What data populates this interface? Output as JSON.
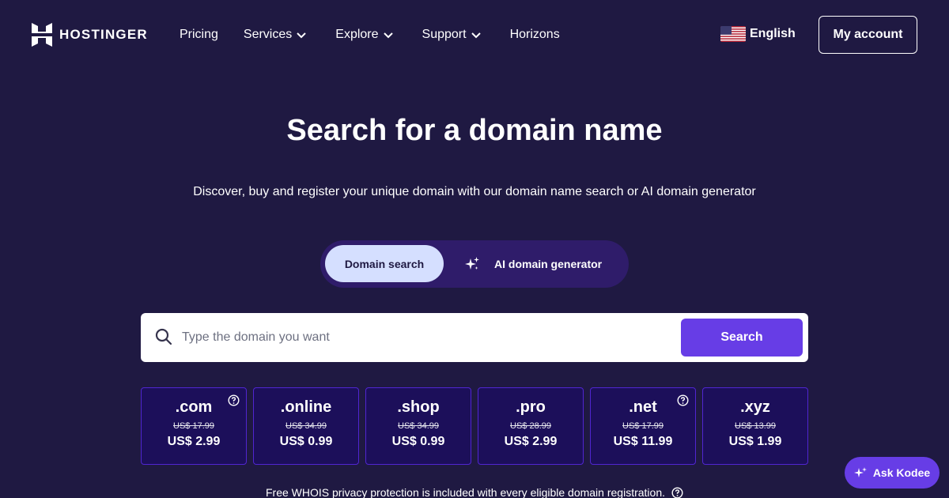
{
  "header": {
    "logo_text": "HOSTINGER",
    "nav": [
      {
        "label": "Pricing",
        "has_dropdown": false
      },
      {
        "label": "Services",
        "has_dropdown": true
      },
      {
        "label": "Explore",
        "has_dropdown": true
      },
      {
        "label": "Support",
        "has_dropdown": true
      },
      {
        "label": "Horizons",
        "has_dropdown": false
      }
    ],
    "language": {
      "label": "English",
      "flag_icon": "us-flag-icon"
    },
    "account_label": "My account"
  },
  "hero": {
    "title": "Search for a domain name",
    "subtitle": "Discover, buy and register your unique domain with our domain name search or AI domain generator"
  },
  "toggle": {
    "active_label": "Domain search",
    "ai_label": "AI domain generator"
  },
  "search": {
    "placeholder": "Type the domain you want",
    "value": "",
    "button_label": "Search"
  },
  "domains": [
    {
      "tld": ".com",
      "old_price": "US$ 17.99",
      "price": "US$ 2.99",
      "has_help": true
    },
    {
      "tld": ".online",
      "old_price": "US$ 34.99",
      "price": "US$ 0.99",
      "has_help": false
    },
    {
      "tld": ".shop",
      "old_price": "US$ 34.99",
      "price": "US$ 0.99",
      "has_help": false
    },
    {
      "tld": ".pro",
      "old_price": "US$ 28.99",
      "price": "US$ 2.99",
      "has_help": false
    },
    {
      "tld": ".net",
      "old_price": "US$ 17.99",
      "price": "US$ 11.99",
      "has_help": true
    },
    {
      "tld": ".xyz",
      "old_price": "US$ 13.99",
      "price": "US$ 1.99",
      "has_help": false
    }
  ],
  "whois_note": "Free WHOIS privacy protection is included with every eligible domain registration.",
  "kodee_label": "Ask Kodee",
  "colors": {
    "background": "#1f1942",
    "accent": "#673de6",
    "card_bg": "#1c0f5a",
    "card_border": "#5025d1",
    "toggle_active": "#d5dfff"
  }
}
